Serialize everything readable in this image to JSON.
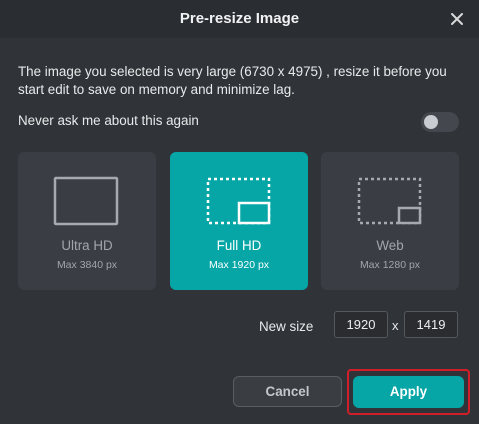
{
  "dialog": {
    "title": "Pre-resize Image",
    "close_icon": "close-icon",
    "message": "The image you selected is very large (6730 x 4975) , resize it before you start edit to save on memory and minimize lag.",
    "never_ask_label": "Never ask me about this again",
    "never_ask_enabled": false
  },
  "sizes": [
    {
      "name": "Ultra HD",
      "sub": "Max 3840 px",
      "selected": false,
      "icon": "ultra-hd-icon"
    },
    {
      "name": "Full HD",
      "sub": "Max 1920 px",
      "selected": true,
      "icon": "full-hd-icon"
    },
    {
      "name": "Web",
      "sub": "Max 1280 px",
      "selected": false,
      "icon": "web-size-icon"
    }
  ],
  "new_size": {
    "label": "New size",
    "width": "1920",
    "separator": "x",
    "height": "1419"
  },
  "buttons": {
    "cancel": "Cancel",
    "apply": "Apply"
  },
  "colors": {
    "accent": "#06a5a6",
    "highlight_outline": "#d11f2a",
    "background": "#303338"
  }
}
